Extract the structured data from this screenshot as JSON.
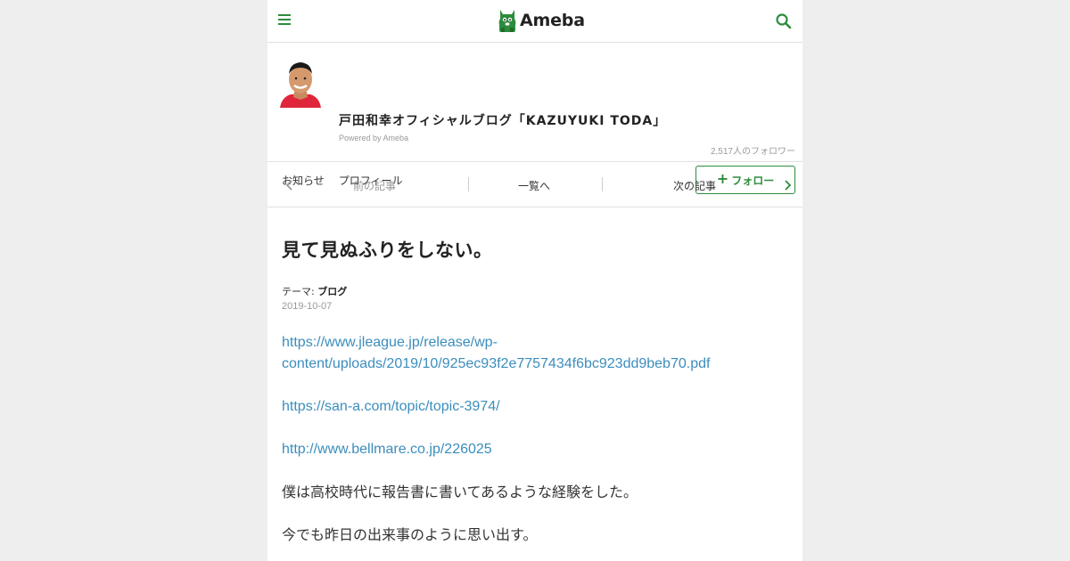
{
  "header": {
    "logo_text": "Ameba",
    "menu_icon": "hamburger-menu-icon",
    "search_icon": "search-icon",
    "accent_color": "#2d8c3c"
  },
  "blog": {
    "title": "戸田和幸オフィシャルブログ「KAZUYUKI TODA」",
    "powered_by": "Powered by Ameba",
    "followers": "2,517人のフォロワー",
    "nav": [
      "お知らせ",
      "プロフィール"
    ],
    "follow_button": "フォロー"
  },
  "pager": {
    "prev": "前の記事",
    "list": "一覧へ",
    "next": "次の記事"
  },
  "article": {
    "title": "見て見ぬふりをしない。",
    "theme_label": "テーマ:",
    "theme": "ブログ",
    "date": "2019-10-07",
    "link1_line1": "https://www.jleague.jp/release/wp-",
    "link1_line2": "content/uploads/2019/10/925ec93f2e7757434f6bc923dd9beb70.pdf",
    "link2": "https://san-a.com/topic/topic-3974/",
    "link3": "http://www.bellmare.co.jp/226025",
    "para1": "僕は高校時代に報告書に書いてあるような経験をした。",
    "para2": "今でも昨日の出来事のように思い出す。",
    "link_color": "#3b8dbd"
  }
}
